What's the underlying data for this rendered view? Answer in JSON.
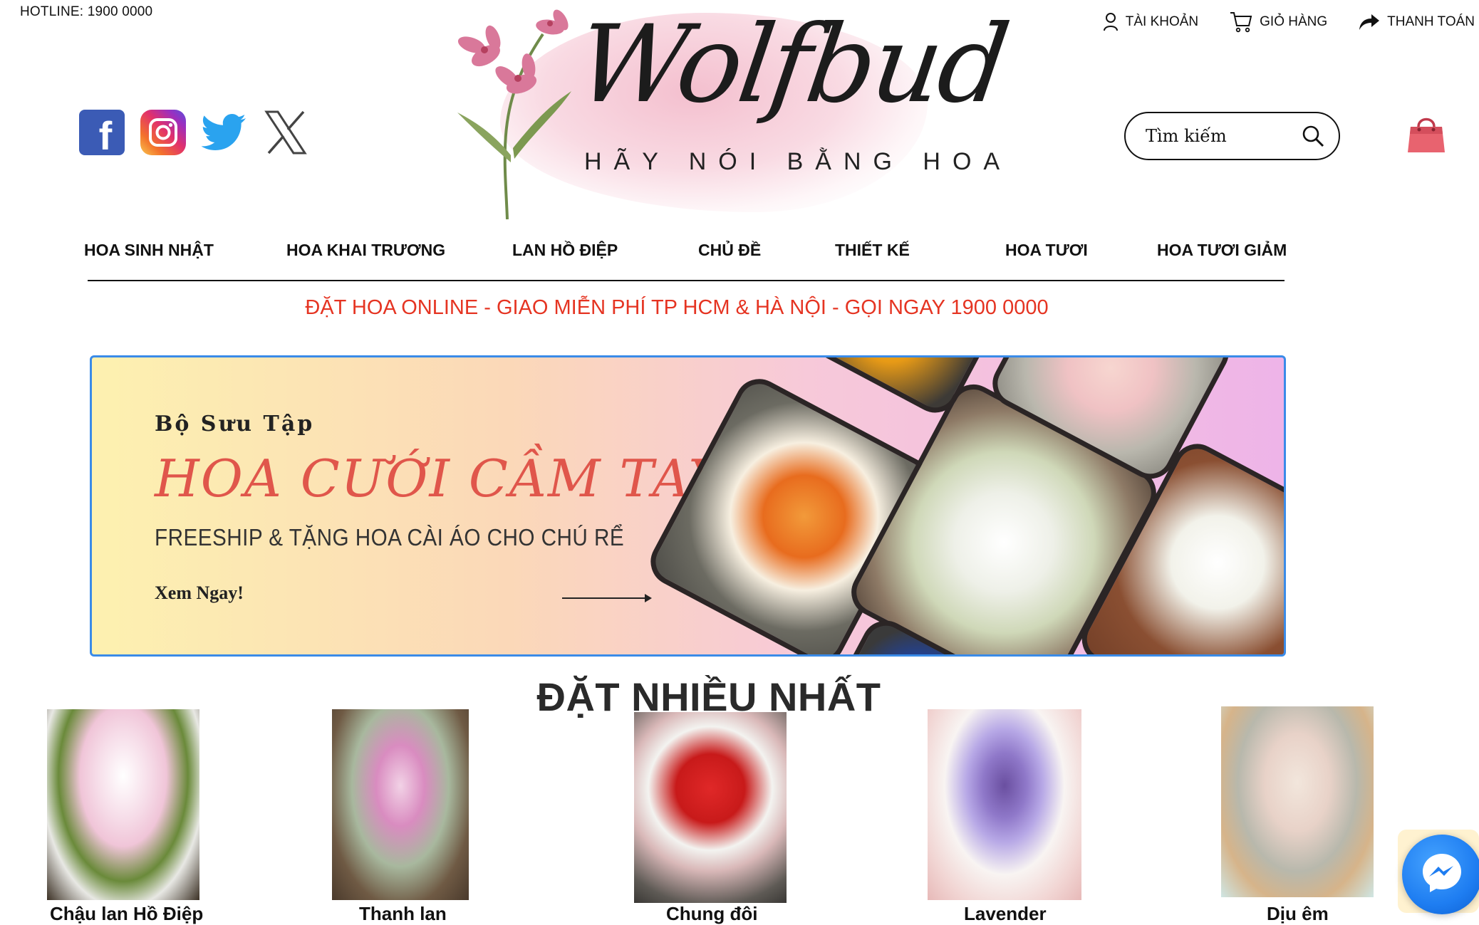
{
  "header": {
    "hotline": "HOTLINE: 1900 0000",
    "account_label": "TÀI KHOẢN",
    "cart_label": "GIỎ HÀNG",
    "checkout_label": "THANH TOÁN"
  },
  "brand": {
    "logo_script": "Wolfbud",
    "tagline": "HÃY NÓI BẰNG HOA"
  },
  "social": [
    "facebook-icon",
    "instagram-icon",
    "twitter-icon",
    "x-icon"
  ],
  "search": {
    "placeholder": "Tìm kiếm"
  },
  "nav": [
    "HOA SINH NHẬT",
    "HOA KHAI TRƯƠNG",
    "LAN HỒ ĐIỆP",
    "CHỦ ĐỀ",
    "THIẾT KẾ",
    "HOA TƯƠI",
    "HOA TƯƠI GIẢM"
  ],
  "promo": "ĐẶT HOA ONLINE - GIAO MIỄN PHÍ TP HCM & HÀ NỘI - GỌI NGAY 1900 0000",
  "banner": {
    "kicker": "Bộ Sưu Tập",
    "title": "HOA CƯỚI CẦM TAY",
    "subtitle": "FREESHIP & TẶNG HOA CÀI ÁO CHO CHÚ RỂ",
    "cta": "Xem Ngay!"
  },
  "section_title": "ĐẶT NHIỀU NHẤT",
  "products": [
    {
      "name": "Chậu lan Hồ Điệp"
    },
    {
      "name": "Thanh lan"
    },
    {
      "name": "Chung đôi"
    },
    {
      "name": "Lavender"
    },
    {
      "name": "Dịu êm"
    }
  ],
  "colors": {
    "promo_red": "#e53422",
    "banner_border": "#3a8be8",
    "banner_title": "#e0564b",
    "messenger_blue": "#1e7df1"
  }
}
